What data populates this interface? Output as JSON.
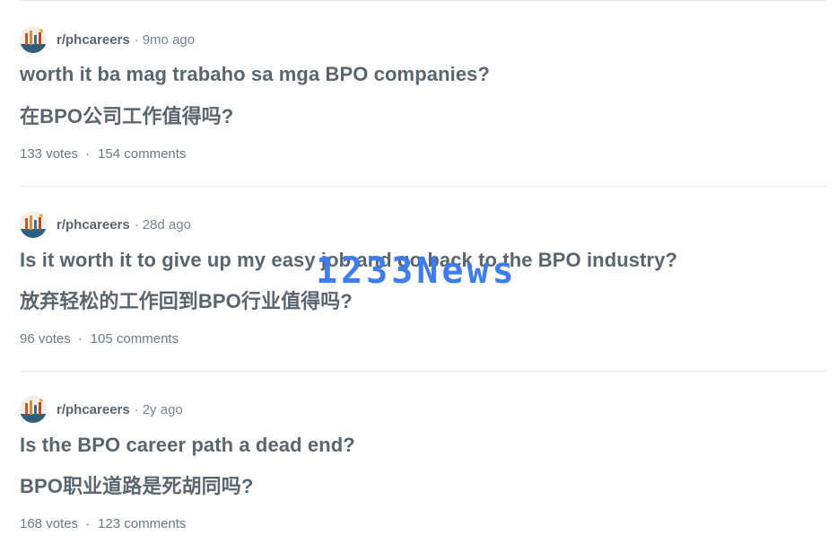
{
  "posts": [
    {
      "subreddit": "r/phcareers",
      "separator": "·",
      "age": "9mo ago",
      "title_en": "worth it ba mag trabaho sa mga BPO companies?",
      "title_zh": "在BPO公司工作值得吗?",
      "votes": "133 votes",
      "stats_separator": "·",
      "comments": "154 comments"
    },
    {
      "subreddit": "r/phcareers",
      "separator": "·",
      "age": "28d ago",
      "title_en": "Is it worth it to give up my easy job and go back to the BPO industry?",
      "title_zh": "放弃轻松的工作回到BPO行业值得吗?",
      "votes": "96 votes",
      "stats_separator": "·",
      "comments": "105 comments"
    },
    {
      "subreddit": "r/phcareers",
      "separator": "·",
      "age": "2y ago",
      "title_en": "Is the BPO career path a dead end?",
      "title_zh": "BPO职业道路是死胡同吗?",
      "votes": "168 votes",
      "stats_separator": "·",
      "comments": "123 comments"
    }
  ],
  "watermark": "1233News",
  "colors": {
    "text": "#5a656e",
    "muted": "#7b858d",
    "divider": "#e6e8ea",
    "watermark": "#3f7cf0"
  },
  "icons": {
    "avatar": "subreddit-avatar-icon"
  }
}
